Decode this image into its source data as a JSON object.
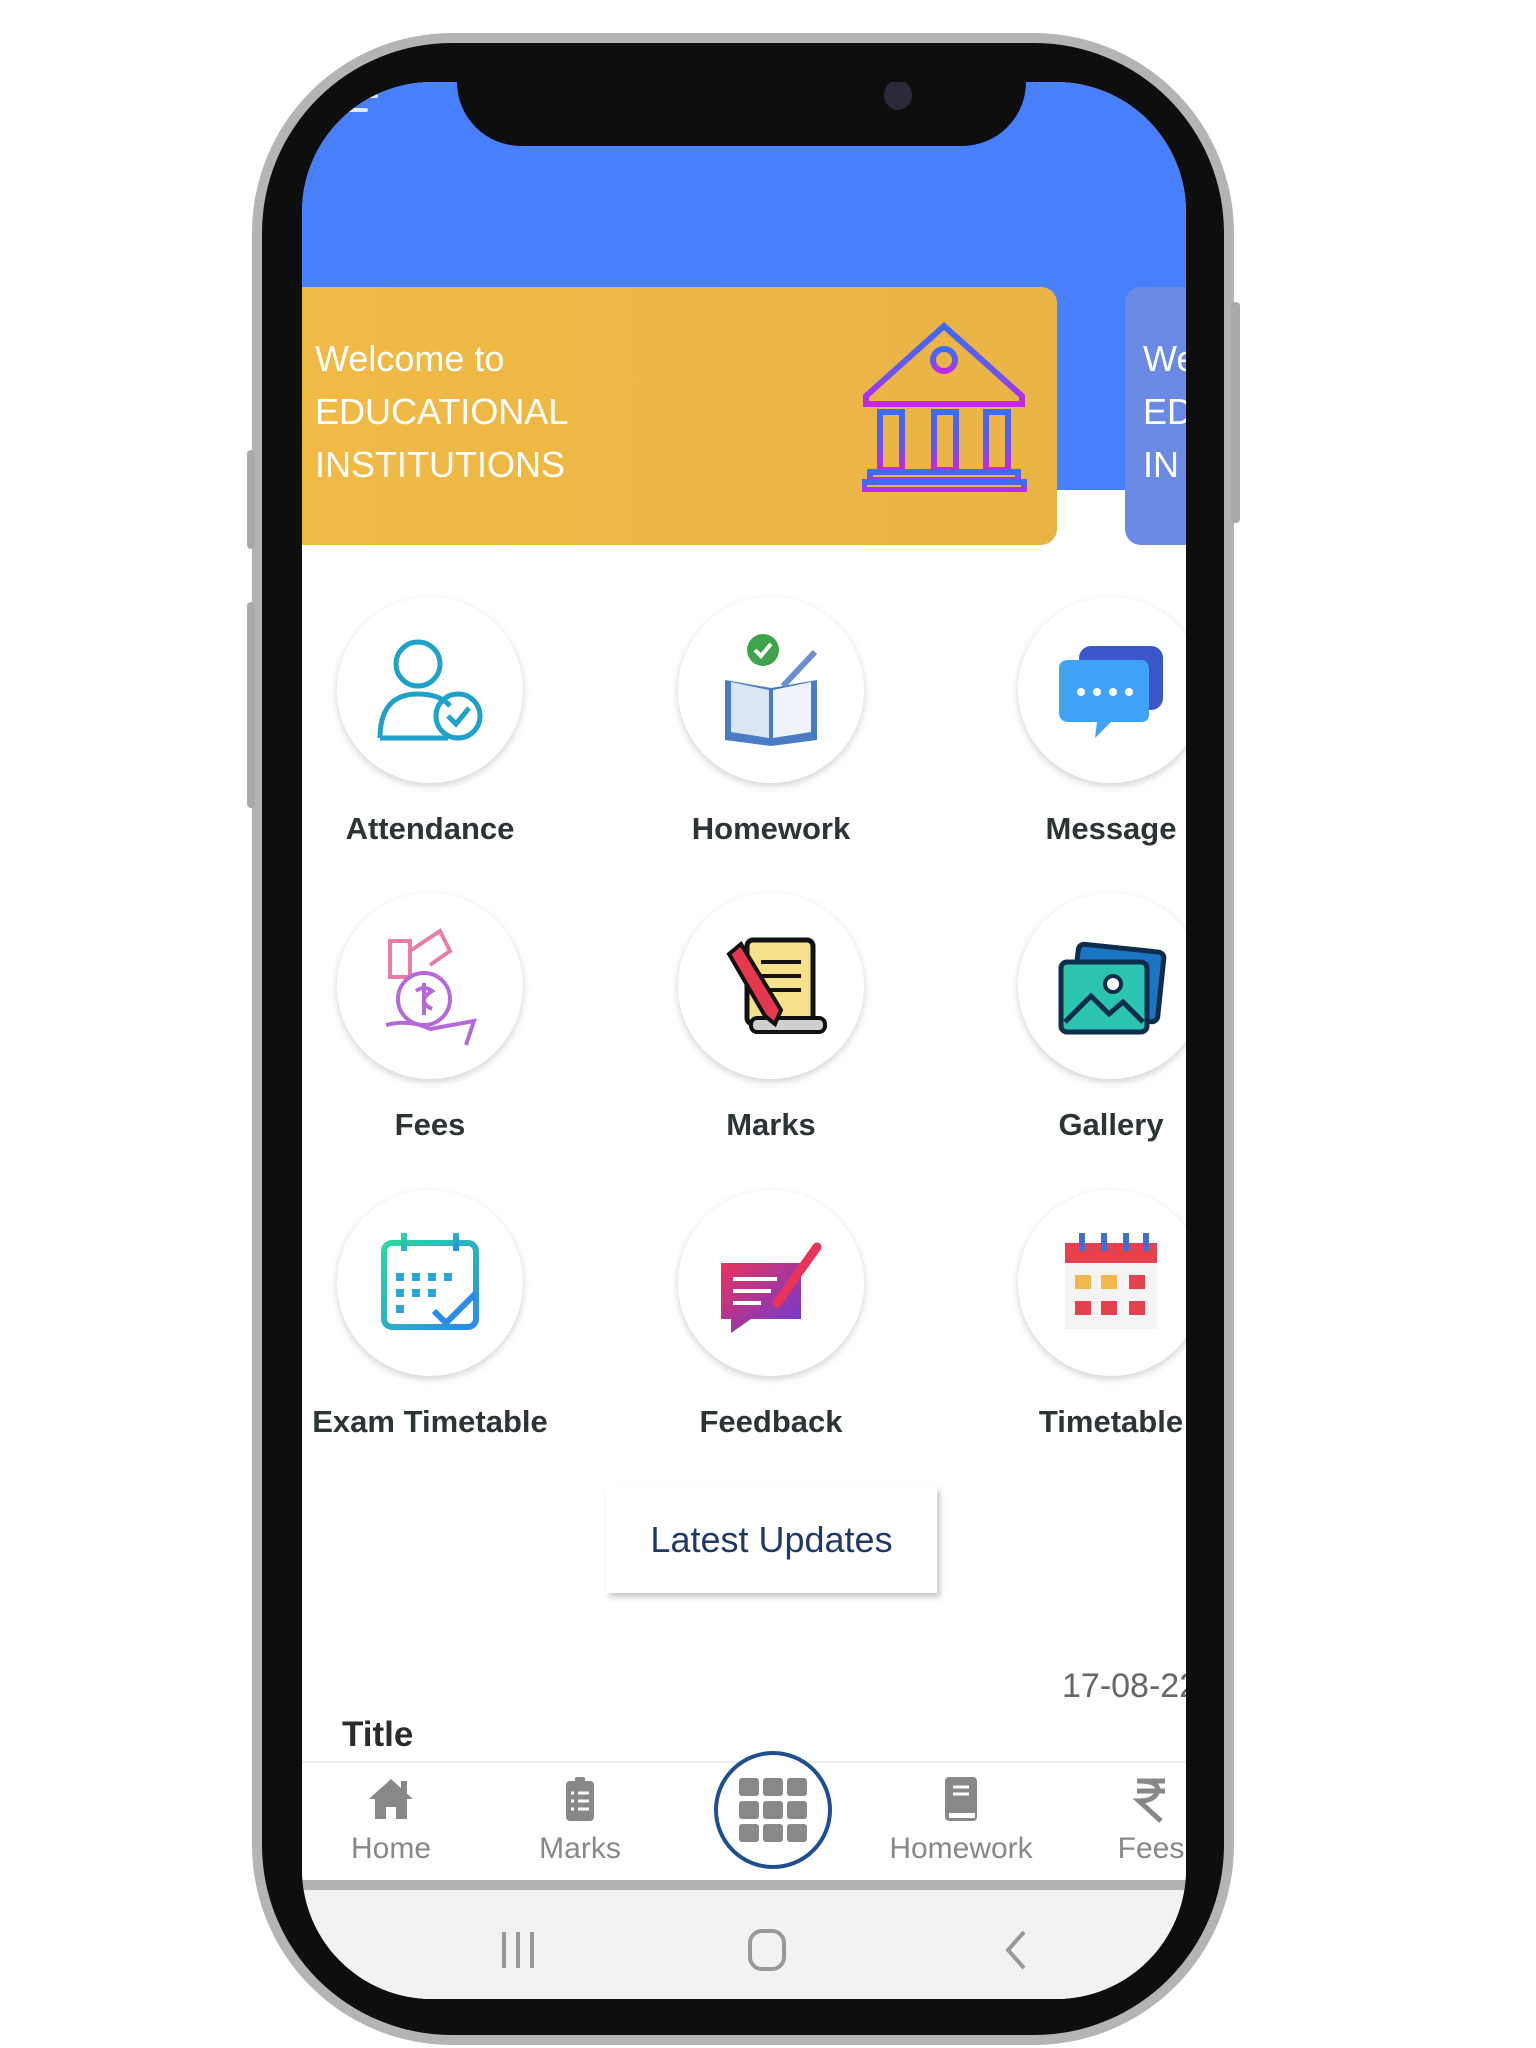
{
  "header": {
    "menu_icon": "hamburger-menu-icon",
    "color": "#4780fa"
  },
  "banner": {
    "cards": [
      {
        "lines": [
          "Welcome to",
          "EDUCATIONAL",
          "INSTITUTIONS"
        ],
        "color": "#f0ba45",
        "icon": "institution-building-icon"
      },
      {
        "lines": [
          "We",
          "ED",
          "IN"
        ],
        "color": "#6a8ae4"
      }
    ]
  },
  "grid": [
    {
      "label": "Attendance",
      "icon": "user-check-icon"
    },
    {
      "label": "Homework",
      "icon": "book-check-icon"
    },
    {
      "label": "Message",
      "icon": "chat-bubble-icon"
    },
    {
      "label": "Fees",
      "icon": "money-bag-hand-icon"
    },
    {
      "label": "Marks",
      "icon": "scroll-pencil-icon"
    },
    {
      "label": "Gallery",
      "icon": "photo-gallery-icon"
    },
    {
      "label": "Exam Timetable",
      "icon": "calendar-check-icon"
    },
    {
      "label": "Feedback",
      "icon": "feedback-note-icon"
    },
    {
      "label": "Timetable",
      "icon": "calendar-grid-icon"
    }
  ],
  "updates": {
    "button": "Latest Updates",
    "date": "17-08-22",
    "title": "Title"
  },
  "bottom_nav": [
    {
      "label": "Home",
      "icon": "home-icon"
    },
    {
      "label": "Marks",
      "icon": "clipboard-list-icon"
    },
    {
      "label": "",
      "icon": "grid-apps-icon"
    },
    {
      "label": "Homework",
      "icon": "book-icon"
    },
    {
      "label": "Fees",
      "icon": "rupee-icon"
    }
  ],
  "system_nav": [
    "recent-apps-icon",
    "home-circle-icon",
    "back-icon"
  ]
}
